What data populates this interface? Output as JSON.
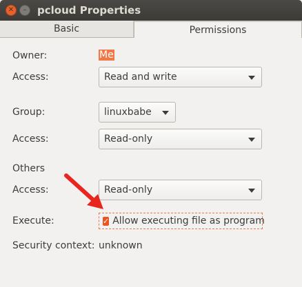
{
  "window": {
    "title": "pcloud Properties"
  },
  "tabs": [
    {
      "label": "Basic"
    },
    {
      "label": "Permissions"
    }
  ],
  "owner": {
    "label": "Owner:",
    "value": "Me",
    "access_label": "Access:",
    "access_value": "Read and write"
  },
  "group": {
    "label": "Group:",
    "value": "linuxbabe",
    "access_label": "Access:",
    "access_value": "Read-only"
  },
  "others": {
    "heading": "Others",
    "access_label": "Access:",
    "access_value": "Read-only"
  },
  "execute": {
    "label": "Execute:",
    "checkbox_label": "Allow executing file as program",
    "checked": true
  },
  "security": {
    "label": "Security context:",
    "value": "unknown"
  },
  "colors": {
    "accent": "#e95420",
    "annotation_arrow": "#e8261f"
  },
  "icons": {
    "close": "close-icon",
    "minimize": "minimize-icon",
    "dropdown": "chevron-down-icon",
    "check": "checkmark-icon"
  }
}
